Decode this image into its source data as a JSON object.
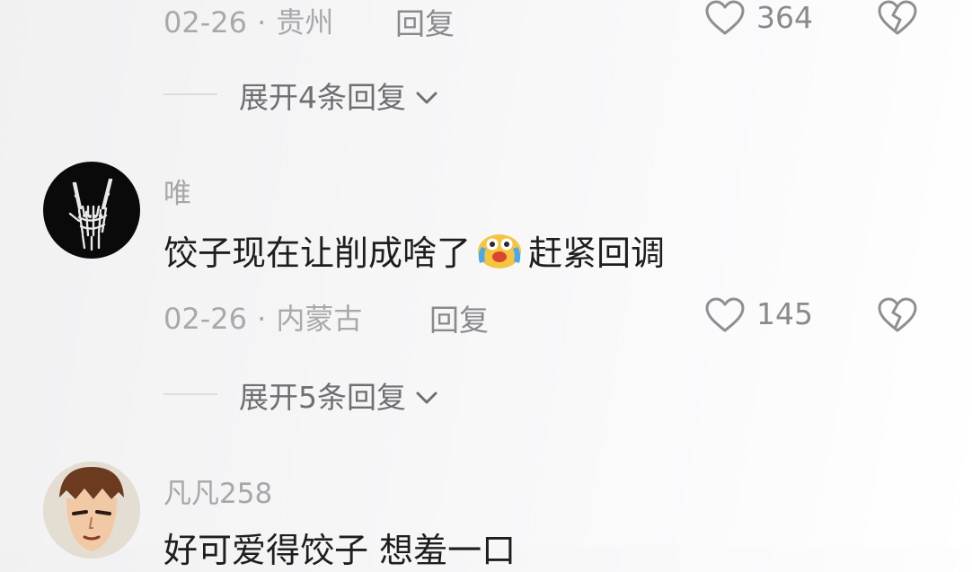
{
  "comment_top": {
    "date": "02-26",
    "location": "贵州",
    "reply_label": "回复",
    "likes": "364",
    "expand_label": "展开4条回复"
  },
  "comment_wei": {
    "username": "唯",
    "text_before": "饺子现在让削成啥了",
    "emoji": "laughing-crying-emoji",
    "text_after": "赶紧回调",
    "date": "02-26",
    "location": "内蒙古",
    "reply_label": "回复",
    "likes": "145",
    "expand_label": "展开5条回复"
  },
  "comment_fanfan": {
    "username": "凡凡258",
    "text": "好可爱得饺子 想羞一口"
  },
  "meta_separator": "·",
  "icons": {
    "like": "heart-outline-icon",
    "dislike": "broken-heart-icon",
    "expand": "chevron-down-icon"
  },
  "colors": {
    "secondary_text": "#a9a9ab",
    "action_text": "#8a8a8d",
    "comment_text": "#1e1e1e"
  }
}
